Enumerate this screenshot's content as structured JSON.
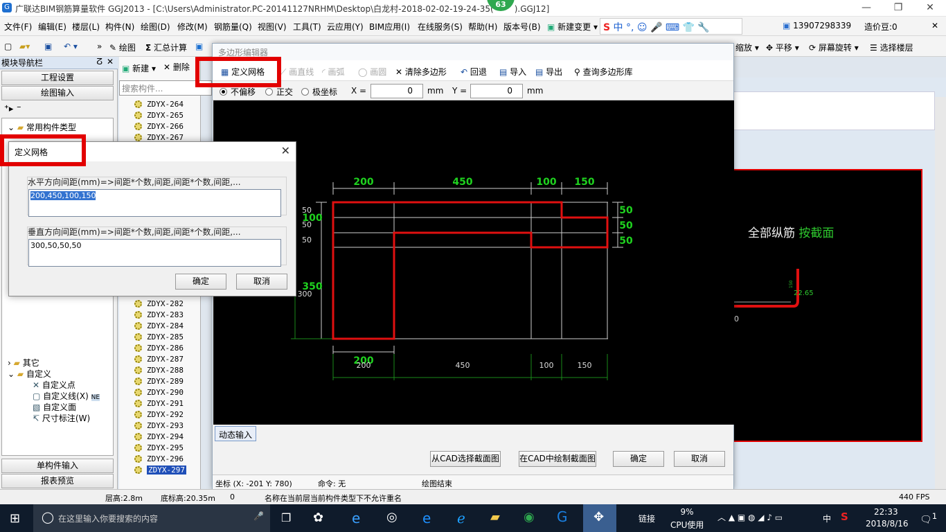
{
  "app": {
    "title": "广联达BIM钢筋算量软件 GGJ2013 - [C:\\Users\\Administrator.PC-20141127NRHM\\Desktop\\白龙村-2018-02-02-19-24-35(",
    "title_suffix": ").GGJ12]",
    "badge": "63"
  },
  "menu": [
    "文件(F)",
    "编辑(E)",
    "楼层(L)",
    "构件(N)",
    "绘图(D)",
    "修改(M)",
    "钢筋量(Q)",
    "视图(V)",
    "工具(T)",
    "云应用(Y)",
    "BIM应用(I)",
    "在线服务(S)",
    "帮助(H)",
    "版本号(B)",
    "新建变更"
  ],
  "account": {
    "phone": "13907298339",
    "price": "造价豆:0"
  },
  "toolbar2": {
    "draw": "绘图",
    "sum": "汇总计算",
    "zoom": "缩放",
    "pan": "平移",
    "rotate": "屏幕旋转",
    "select_floor": "选择楼层"
  },
  "left_nav": {
    "header": "模块导航栏",
    "project_settings": "工程设置",
    "draw_input": "绘图输入",
    "tree": {
      "common": "常用构件类型",
      "other": "其它",
      "custom": "自定义",
      "custom_point": "自定义点",
      "custom_line": "自定义线(X)",
      "new_badge": "NE",
      "custom_face": "自定义面",
      "dim": "尺寸标注(W)"
    },
    "single_input": "单构件输入",
    "report_preview": "报表预览"
  },
  "component_list": {
    "new": "新建",
    "delete": "删除",
    "search_placeholder": "搜索构件...",
    "items_top": [
      "ZDYX-264",
      "ZDYX-265",
      "ZDYX-266",
      "ZDYX-267"
    ],
    "items_bottom": [
      "ZDYX-282",
      "ZDYX-283",
      "ZDYX-284",
      "ZDYX-285",
      "ZDYX-286",
      "ZDYX-287",
      "ZDYX-288",
      "ZDYX-289",
      "ZDYX-290",
      "ZDYX-291",
      "ZDYX-292",
      "ZDYX-293",
      "ZDYX-294",
      "ZDYX-295",
      "ZDYX-296",
      "ZDYX-297"
    ]
  },
  "editor": {
    "title": "多边形编辑器",
    "tools": {
      "define_grid": "定义网格",
      "draw_line": "画直线",
      "draw_arc": "画弧",
      "draw_circle": "画圆",
      "clear": "清除多边形",
      "undo": "回退",
      "import": "导入",
      "export": "导出",
      "query": "查询多边形库"
    },
    "options": {
      "no_offset": "不偏移",
      "ortho": "正交",
      "polar": "极坐标",
      "x_label": "X =",
      "x_value": "0",
      "y_label": "Y =",
      "y_value": "0",
      "unit": "mm"
    },
    "dynamic_input": "动态输入",
    "buttons": {
      "from_cad": "从CAD选择截面图",
      "draw_cad": "在CAD中绘制截面图",
      "ok": "确定",
      "cancel": "取消"
    },
    "status": {
      "coord": "坐标 (X: -201 Y: 780)",
      "cmd": "命令: 无",
      "end": "绘图结束"
    }
  },
  "grid_drawing": {
    "h_spacings": [
      "200",
      "450",
      "100",
      "150"
    ],
    "v_spacings": [
      "300",
      "50",
      "50",
      "50"
    ],
    "v_dims_green": [
      "100",
      "350"
    ],
    "right_dims": [
      "50",
      "50",
      "50"
    ],
    "bottom_dim": "200"
  },
  "dialog": {
    "title": "定义网格",
    "h_label": "水平方向间距(mm)=>间距*个数,间距,间距*个数,间距,...",
    "h_value": "200,450,100,150",
    "v_label": "垂直方向间距(mm)=>间距*个数,间距,间距*个数,间距,...",
    "v_value": "300,50,50,50",
    "ok": "确定",
    "cancel": "取消"
  },
  "right_pane": {
    "text1": "全部纵筋",
    "text2": "按截面",
    "num": "22.65",
    "zero": "0",
    "small": "150"
  },
  "status": {
    "floor_height": "层高:2.8m",
    "bottom_height": "底标高:20.35m",
    "zero": "0",
    "message": "名称在当前层当前构件类型下不允许重名",
    "fps": "440 FPS"
  },
  "taskbar": {
    "search": "在这里输入你要搜索的内容",
    "link": "链接",
    "cpu_pct": "9%",
    "cpu": "CPU使用",
    "ime": "中",
    "time": "22:33",
    "date": "2018/8/16",
    "notif": "1"
  },
  "colors": {
    "highlight": "#e20000",
    "canvas": "#000000",
    "polygon": "#e01010",
    "dim_green": "#1fd21f"
  }
}
